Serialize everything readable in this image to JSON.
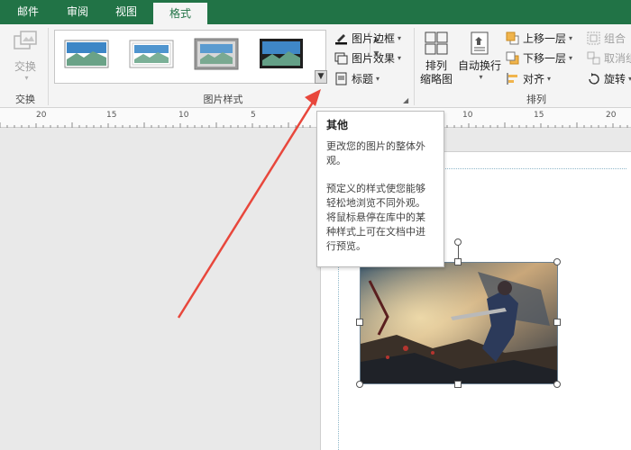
{
  "tabs": [
    {
      "label": "邮件",
      "active": false
    },
    {
      "label": "审阅",
      "active": false
    },
    {
      "label": "视图",
      "active": false
    },
    {
      "label": "格式",
      "active": true
    }
  ],
  "ribbon": {
    "swap": {
      "button_label": "交换",
      "group_label": "交换"
    },
    "picture_styles": {
      "group_label": "图片样式",
      "border_label": "图片边框",
      "effect_label": "图片效果",
      "caption_label": "标题"
    },
    "arrange": {
      "group_label": "排列",
      "arrange_thumbnails_line1": "排列",
      "arrange_thumbnails_line2": "缩略图",
      "wrap_text_label": "自动换行",
      "bring_forward_label": "上移一层",
      "send_backward_label": "下移一层",
      "align_label": "对齐",
      "group_label_btn": "组合",
      "ungroup_label": "取消组",
      "rotate_label": "旋转"
    }
  },
  "ruler": {
    "numbers": [
      "20",
      "15",
      "10",
      "5",
      "",
      "10",
      "15",
      "20"
    ]
  },
  "tooltip": {
    "title": "其他",
    "line1": "更改您的图片的整体外观。",
    "line2": "预定义的样式使您能够轻松地浏览不同外观。将鼠标悬停在库中的某种样式上可在文档中进行预览。"
  },
  "colors": {
    "accent": "#217346",
    "arrow": "#e8473c"
  }
}
